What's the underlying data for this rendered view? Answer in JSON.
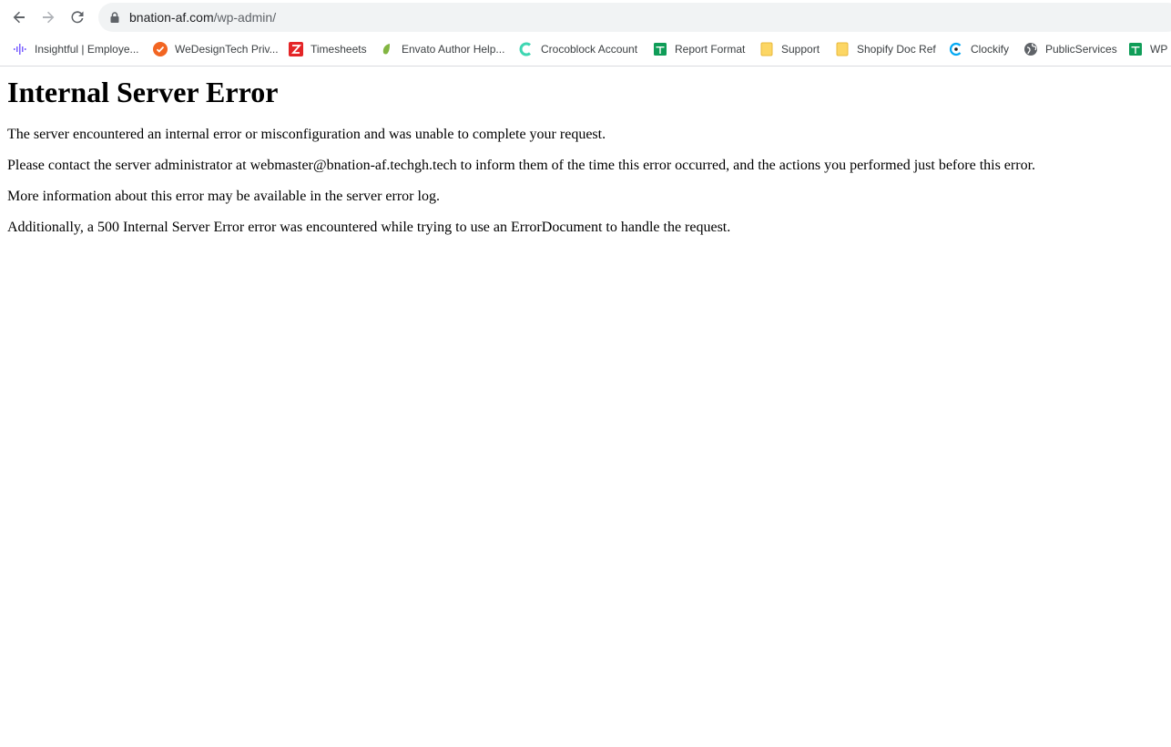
{
  "browser": {
    "address_bar": {
      "host": "bnation-af.com",
      "path": "/wp-admin/"
    },
    "nav": {
      "back_icon": "arrow-left-icon",
      "forward_icon": "arrow-right-icon",
      "reload_icon": "reload-icon",
      "lock_icon": "lock-icon"
    },
    "bookmarks": [
      {
        "label": "Insightful | Employe...",
        "icon": "insightful-icon",
        "color": "#7b61ff"
      },
      {
        "label": "WeDesignTech Priv...",
        "icon": "wedesigntech-icon",
        "color": "#f26522"
      },
      {
        "label": "Timesheets",
        "icon": "zoho-z-icon",
        "color": "#e42527"
      },
      {
        "label": "Envato Author Help...",
        "icon": "envato-leaf-icon",
        "color": "#82b541"
      },
      {
        "label": "Crocoblock Account",
        "icon": "crocoblock-icon",
        "color": "#3ed6b2"
      },
      {
        "label": "Report Format",
        "icon": "sheets-icon",
        "color": "#0f9d58"
      },
      {
        "label": "Support",
        "icon": "folder-icon",
        "color": "#fcd664"
      },
      {
        "label": "Shopify Doc Ref",
        "icon": "folder-icon",
        "color": "#fcd664"
      },
      {
        "label": "Clockify",
        "icon": "clockify-icon",
        "color": "#03a9f4"
      },
      {
        "label": "PublicServices",
        "icon": "globe-icon",
        "color": "#5f6368"
      },
      {
        "label": "WP -",
        "icon": "sheets-icon",
        "color": "#0f9d58"
      }
    ]
  },
  "page": {
    "title": "Internal Server Error",
    "paragraphs": [
      "The server encountered an internal error or misconfiguration and was unable to complete your request.",
      "Please contact the server administrator at webmaster@bnation-af.techgh.tech to inform them of the time this error occurred, and the actions you performed just before this error.",
      "More information about this error may be available in the server error log.",
      "Additionally, a 500 Internal Server Error error was encountered while trying to use an ErrorDocument to handle the request."
    ]
  }
}
